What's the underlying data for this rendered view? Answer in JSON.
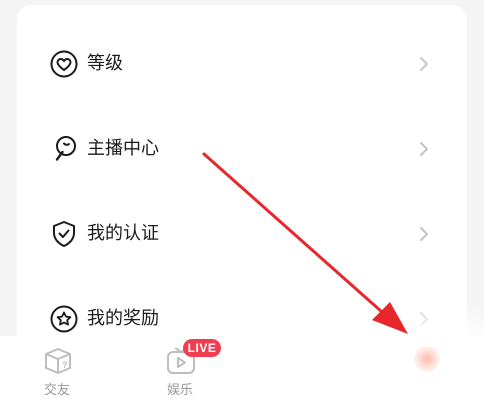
{
  "menu": {
    "items": [
      {
        "label": "等级",
        "icon": "heart-badge-icon"
      },
      {
        "label": "主播中心",
        "icon": "microphone-icon"
      },
      {
        "label": "我的认证",
        "icon": "shield-check-icon"
      },
      {
        "label": "我的奖励",
        "icon": "star-badge-icon"
      }
    ]
  },
  "bottom_nav": {
    "items": [
      {
        "label": "交友",
        "icon": "cube-question-icon"
      },
      {
        "label": "娱乐",
        "icon": "tv-play-icon"
      }
    ],
    "badge": "LIVE"
  },
  "colors": {
    "badge": "#ef3e52",
    "annotation_arrow": "#e8262b",
    "icon_stroke": "#1b1b1b",
    "nav_inactive": "#bbbbbb"
  }
}
